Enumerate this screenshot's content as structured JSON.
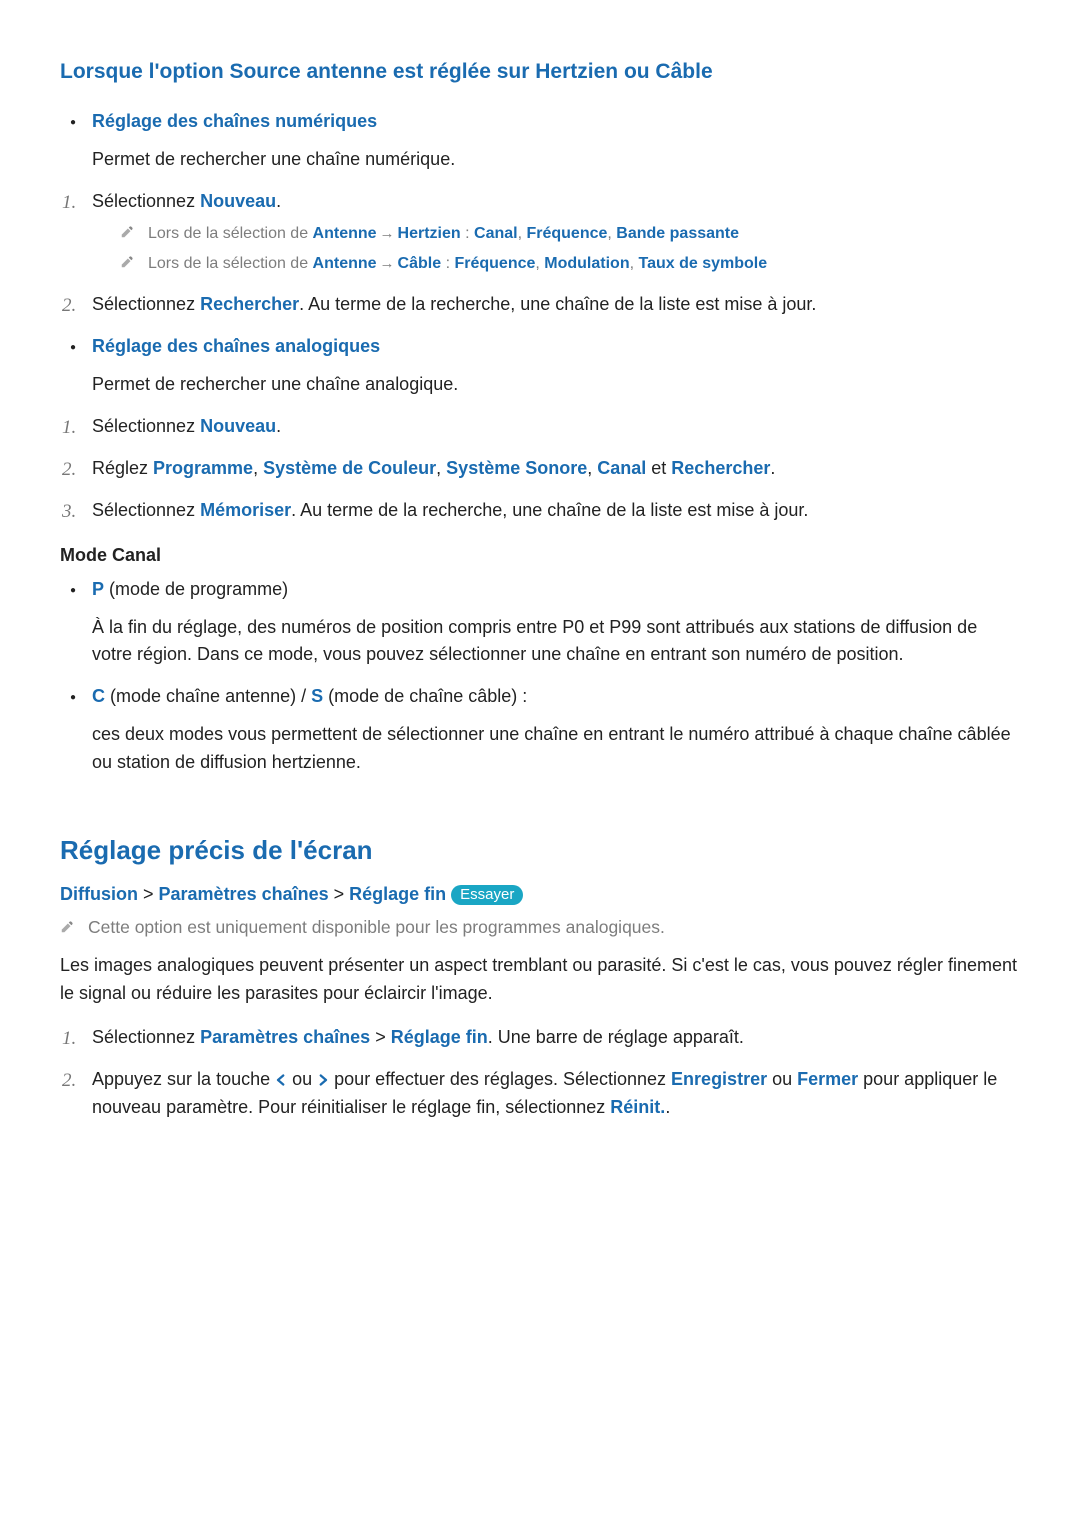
{
  "s1": {
    "title": "Lorsque l'option Source antenne est réglée sur Hertzien ou Câble",
    "digital": {
      "heading": "Réglage des chaînes numériques",
      "desc": "Permet de rechercher une chaîne numérique.",
      "step1_a": "Sélectionnez ",
      "step1_b": "Nouveau",
      "step1_c": ".",
      "note1": {
        "a": "Lors de la sélection de ",
        "b": "Antenne",
        "c": "Hertzien",
        "d": " : ",
        "e": "Canal",
        "f": ", ",
        "g": "Fréquence",
        "h": ", ",
        "i": "Bande passante"
      },
      "note2": {
        "a": "Lors de la sélection de ",
        "b": "Antenne",
        "c": "Câble",
        "d": " : ",
        "e": "Fréquence",
        "f": ", ",
        "g": "Modulation",
        "h": ", ",
        "i": "Taux de symbole"
      },
      "step2_a": "Sélectionnez ",
      "step2_b": "Rechercher",
      "step2_c": ". Au terme de la recherche, une chaîne de la liste est mise à jour."
    },
    "analog": {
      "heading": "Réglage des chaînes analogiques",
      "desc": "Permet de rechercher une chaîne analogique.",
      "step1_a": "Sélectionnez ",
      "step1_b": "Nouveau",
      "step1_c": ".",
      "step2_a": "Réglez ",
      "step2_b": "Programme",
      "step2_c": ", ",
      "step2_d": "Système de Couleur",
      "step2_e": ", ",
      "step2_f": "Système Sonore",
      "step2_g": ", ",
      "step2_h": "Canal",
      "step2_i": " et ",
      "step2_j": "Rechercher",
      "step2_k": ".",
      "step3_a": "Sélectionnez ",
      "step3_b": "Mémoriser",
      "step3_c": ". Au terme de la recherche, une chaîne de la liste est mise à jour."
    },
    "mode": {
      "heading": "Mode Canal",
      "p_label": "P",
      "p_text": " (mode de programme)",
      "p_desc": "À la fin du réglage, des numéros de position compris entre P0 et P99 sont attribués aux stations de diffusion de votre région. Dans ce mode, vous pouvez sélectionner une chaîne en entrant son numéro de position.",
      "c_label": "C",
      "c_text1": " (mode chaîne antenne) / ",
      "s_label": "S",
      "c_text2": " (mode de chaîne câble) :",
      "cs_desc": "ces deux modes vous permettent de sélectionner une chaîne en entrant le numéro attribué à chaque chaîne câblée ou station de diffusion hertzienne."
    }
  },
  "s2": {
    "title": "Réglage précis de l'écran",
    "crumbs": {
      "a": "Diffusion",
      "b": "Paramètres chaînes",
      "c": "Réglage fin",
      "sep": " > ",
      "badge": "Essayer"
    },
    "note": "Cette option est uniquement disponible pour les programmes analogiques.",
    "body": "Les images analogiques peuvent présenter un aspect tremblant ou parasité. Si c'est le cas, vous pouvez régler finement le signal ou réduire les parasites pour éclaircir l'image.",
    "step1_a": "Sélectionnez ",
    "step1_b": "Paramètres chaînes",
    "step1_c": " > ",
    "step1_d": "Réglage fin",
    "step1_e": ". Une barre de réglage apparaît.",
    "step2_a": "Appuyez sur la touche ",
    "step2_b": " ou ",
    "step2_c": " pour effectuer des réglages. Sélectionnez ",
    "step2_d": "Enregistrer",
    "step2_e": " ou ",
    "step2_f": "Fermer",
    "step2_g": " pour appliquer le nouveau paramètre. Pour réinitialiser le réglage fin, sélectionnez ",
    "step2_h": "Réinit.",
    "step2_i": "."
  }
}
